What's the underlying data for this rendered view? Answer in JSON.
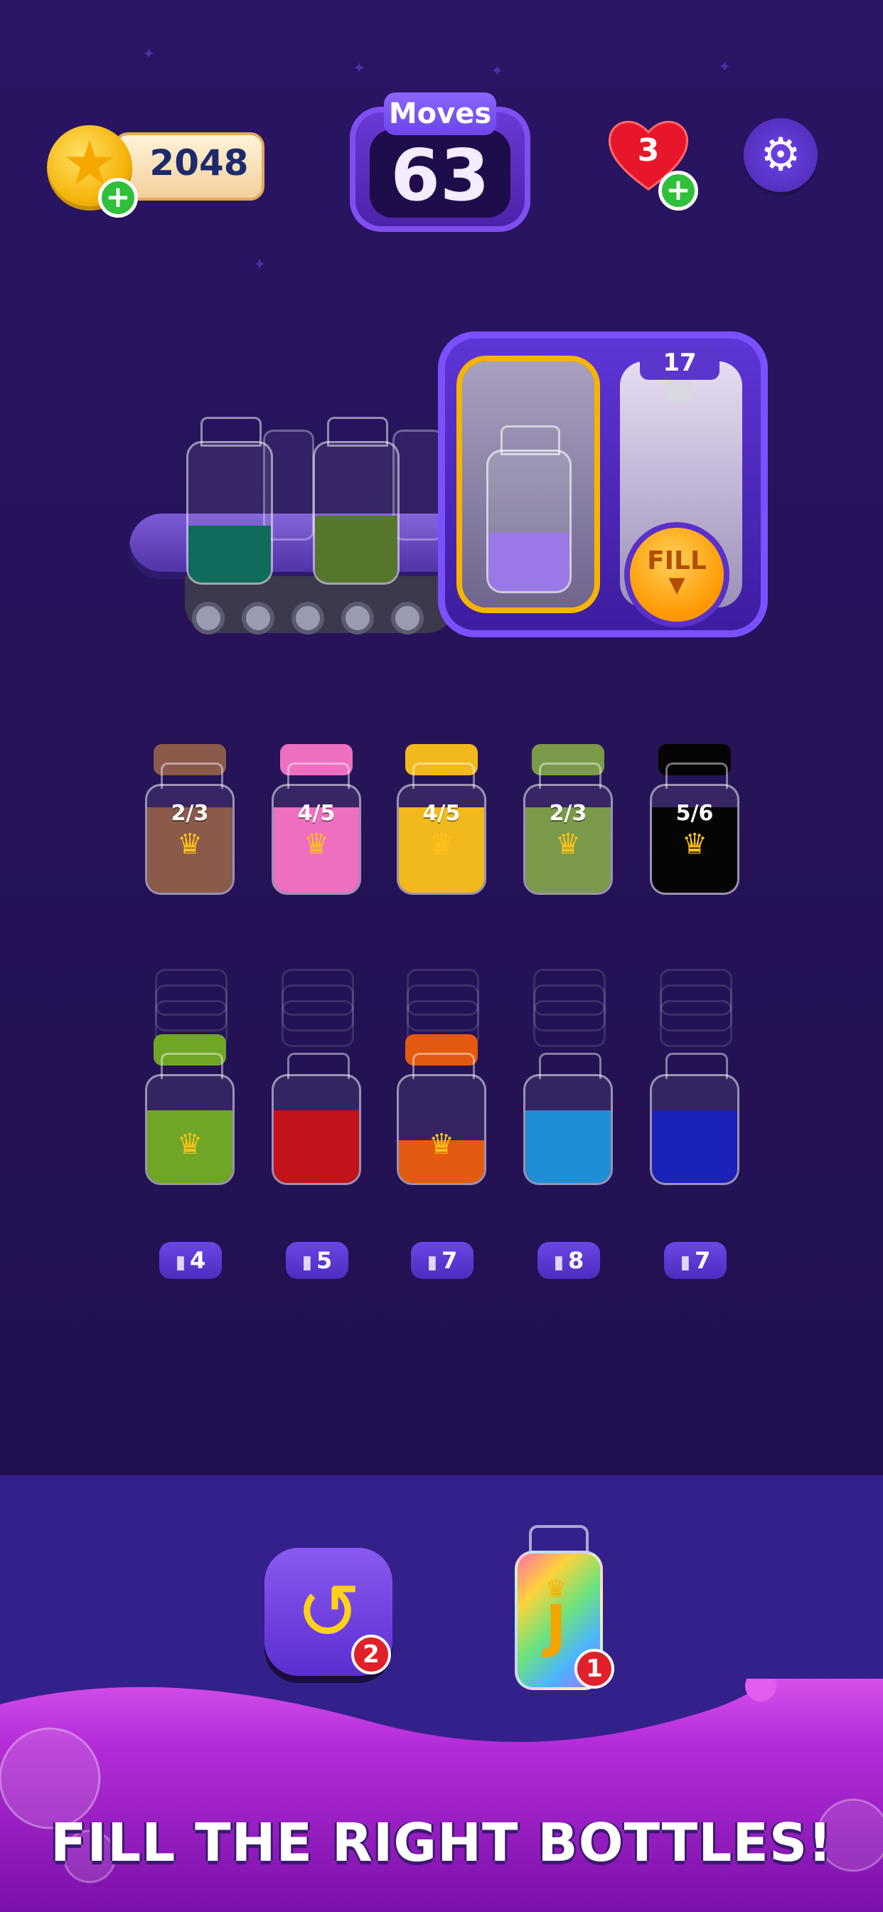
{
  "hud": {
    "coins": "2048",
    "moves_label": "Moves",
    "moves": "63",
    "lives": "3"
  },
  "machine": {
    "capacity": "17",
    "fill_label": "FILL"
  },
  "target_bottles": [
    {
      "fraction": "2/3",
      "color": "#8a5a4a"
    },
    {
      "fraction": "4/5",
      "color": "#ee6fbf"
    },
    {
      "fraction": "4/5",
      "color": "#f2b91c"
    },
    {
      "fraction": "2/3",
      "color": "#7a9a4a"
    },
    {
      "fraction": "5/6",
      "color": "#050505"
    }
  ],
  "stack_bottles": [
    {
      "color": "#6fa626",
      "count": "4"
    },
    {
      "color": "#c2121a",
      "count": "5"
    },
    {
      "color": "#e35a10",
      "count": "7"
    },
    {
      "color": "#1e8fd6",
      "count": "8"
    },
    {
      "color": "#1a22b8",
      "count": "7"
    }
  ],
  "boosters": {
    "undo_count": "2",
    "joker_label": "J",
    "joker_count": "1"
  },
  "banner": "FILL THE RIGHT BOTTLES!"
}
